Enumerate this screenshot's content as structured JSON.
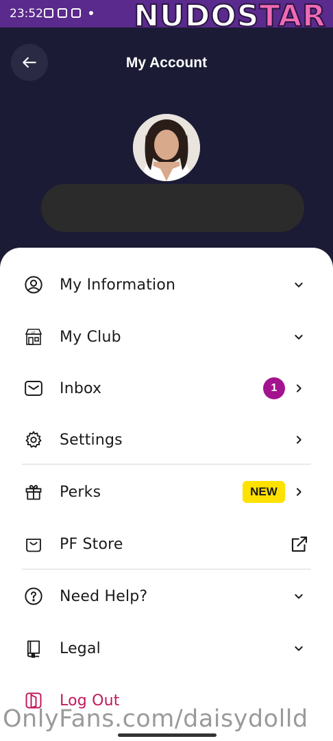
{
  "status_bar": {
    "time": "23:52",
    "color": "#5a2a8c"
  },
  "watermark_top": {
    "main": "NUDOS",
    "accent": "TAR"
  },
  "header": {
    "title": "My Account",
    "back_icon": "arrow-left-icon",
    "background": "#1b1b35"
  },
  "menu": {
    "items": [
      {
        "label": "My Information",
        "icon": "user-circle-icon",
        "trail": "chevron-down-icon"
      },
      {
        "label": "My Club",
        "icon": "store-icon",
        "trail": "chevron-down-icon"
      },
      {
        "label": "Inbox",
        "icon": "mail-icon",
        "trail": "chevron-right-icon",
        "badge": "1"
      },
      {
        "label": "Settings",
        "icon": "gear-icon",
        "trail": "chevron-right-icon"
      },
      {
        "label": "Perks",
        "icon": "gift-icon",
        "trail": "chevron-right-icon",
        "tag": "NEW"
      },
      {
        "label": "PF Store",
        "icon": "shopping-bag-icon",
        "trail": "external-link-icon"
      },
      {
        "label": "Need Help?",
        "icon": "help-circle-icon",
        "trail": "chevron-down-icon"
      },
      {
        "label": "Legal",
        "icon": "book-icon",
        "trail": "chevron-down-icon"
      },
      {
        "label": "Log Out",
        "icon": "logout-icon"
      }
    ],
    "badge_color": "#a4138f",
    "tag_color": "#ffe100",
    "logout_color": "#c2185b"
  },
  "watermark_bottom": "OnlyFans.com/daisydolld"
}
